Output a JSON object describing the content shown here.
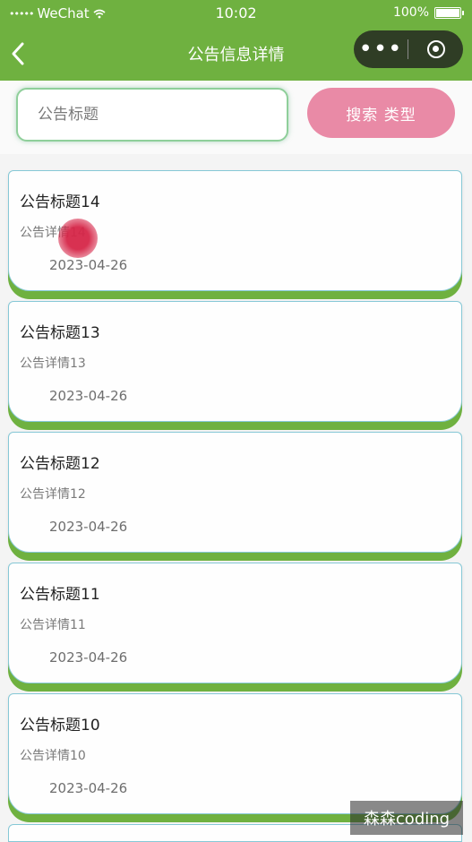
{
  "status_bar": {
    "carrier": "WeChat",
    "signal_dots": "•••••",
    "time": "10:02",
    "battery": "100%"
  },
  "nav": {
    "title": "公告信息详情",
    "back_icon": "chevron-left-icon",
    "more_icon": "more-dots-icon",
    "close_icon": "target-circle-icon",
    "more_glyph": "•••"
  },
  "search": {
    "placeholder": "公告标题",
    "value": "",
    "button_label": "搜索  类型"
  },
  "notices": [
    {
      "title": "公告标题14",
      "detail": "公告详情14",
      "date": "2023-04-26"
    },
    {
      "title": "公告标题13",
      "detail": "公告详情13",
      "date": "2023-04-26"
    },
    {
      "title": "公告标题12",
      "detail": "公告详情12",
      "date": "2023-04-26"
    },
    {
      "title": "公告标题11",
      "detail": "公告详情11",
      "date": "2023-04-26"
    },
    {
      "title": "公告标题10",
      "detail": "公告详情10",
      "date": "2023-04-26"
    }
  ],
  "watermark": "森森coding",
  "colors": {
    "primary_green": "#6fb140",
    "search_button_pink": "#e98aa6",
    "card_border": "#86c8d6",
    "capsule_dark": "#2f3d25"
  }
}
